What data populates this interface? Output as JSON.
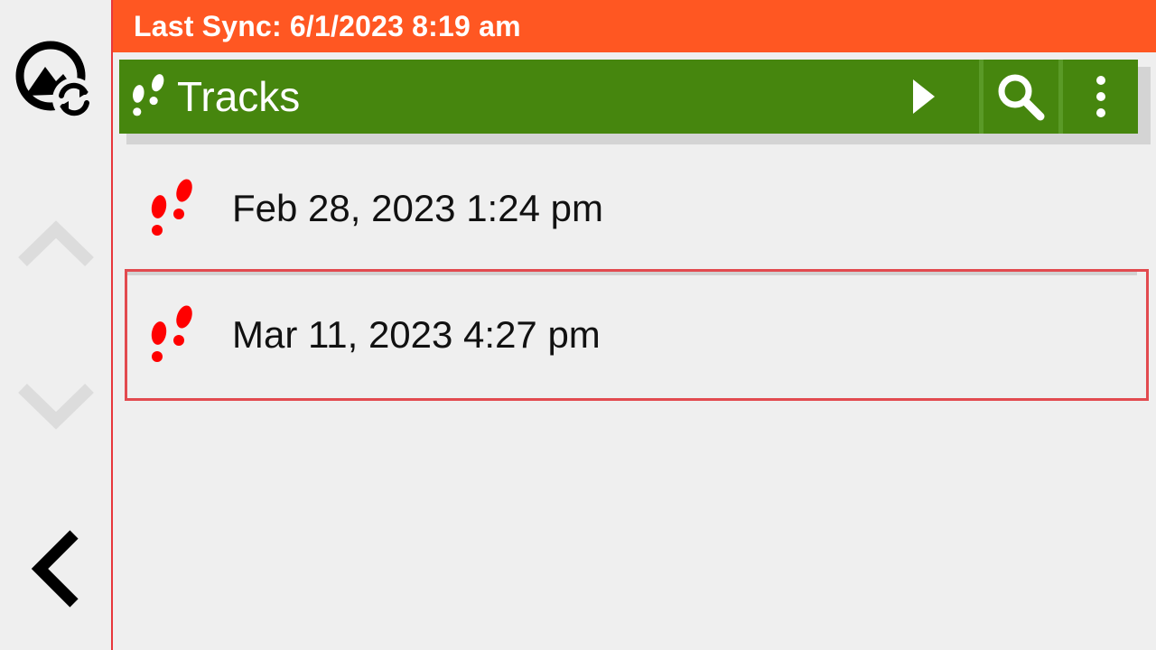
{
  "sync": {
    "text": "Last Sync: 6/1/2023 8:19 am",
    "color": "#ff5722"
  },
  "rail": {
    "sync_icon": "map-sync-icon",
    "up_icon": "chevron-up-icon",
    "down_icon": "chevron-down-icon",
    "back_icon": "chevron-left-icon",
    "divider_color": "#e8373b"
  },
  "toolbar": {
    "title": "Tracks",
    "title_icon": "footprints-icon",
    "color": "#46860e",
    "play_icon": "play-icon",
    "search_icon": "search-icon",
    "menu_icon": "more-vertical-icon"
  },
  "tracks": [
    {
      "label": "Feb 28, 2023 1:24 pm",
      "icon": "footprints-icon",
      "selected": false
    },
    {
      "label": "Mar 11, 2023 4:27 pm",
      "icon": "footprints-icon",
      "selected": true
    }
  ],
  "colors": {
    "track_icon": "#ff0000",
    "selection_border": "#e24a4f"
  }
}
